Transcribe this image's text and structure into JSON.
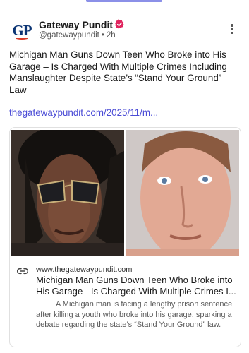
{
  "post": {
    "author_name": "Gateway Pundit",
    "avatar_text": "GP",
    "handle": "@gatewaypundit",
    "separator": "•",
    "time_ago": "2h",
    "text": "Michigan Man Guns Down Teen Who Broke into His Garage – Is Charged With Multiple Crimes Including Manslaughter Despite State’s “Stand Your Ground” Law",
    "link_text": "thegatewaypundit.com/2025/11/m..."
  },
  "link_card": {
    "domain": "www.thegatewaypundit.com",
    "title": "Michigan Man Guns Down Teen Who Broke into His Garage - Is Charged With Multiple Crimes I...",
    "description": "A Michigan man is facing a lengthy prison sentence after killing a youth who broke into his garage, sparking a debate regarding the state’s “Stand Your Ground” law."
  },
  "icons": {
    "verified": "verified-badge-icon",
    "more": "more-vertical-icon",
    "link": "link-icon"
  },
  "colors": {
    "accent": "#8b90e8",
    "link": "#4b4cd6",
    "verified_badge": "#e0245e",
    "avatar_brand": "#0c3574"
  }
}
